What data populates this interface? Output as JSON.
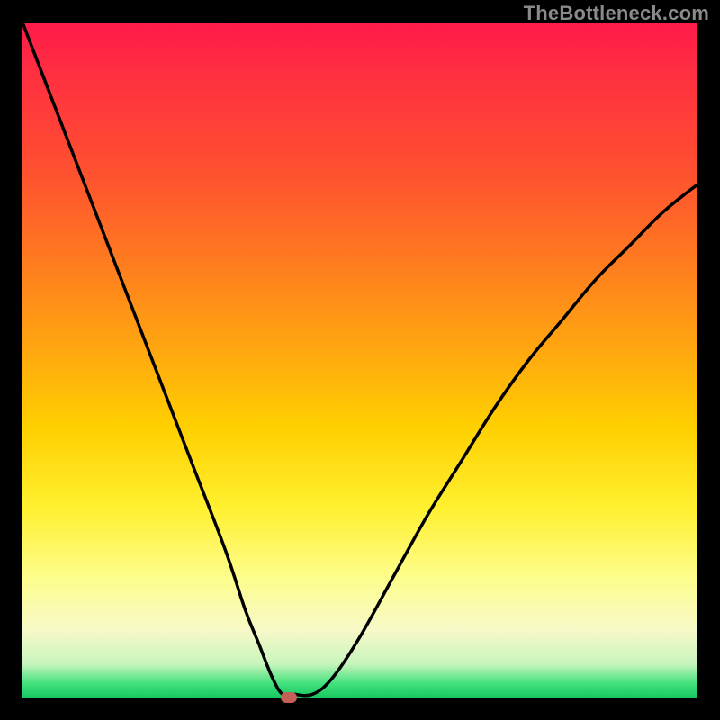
{
  "watermark": "TheBottleneck.com",
  "colors": {
    "frame": "#000000",
    "curve": "#000000",
    "marker": "#c36058"
  },
  "chart_data": {
    "type": "line",
    "title": "",
    "xlabel": "",
    "ylabel": "",
    "xlim": [
      0,
      100
    ],
    "ylim": [
      0,
      100
    ],
    "grid": false,
    "legend": false,
    "gradient_top_color": "#ff1a4a",
    "gradient_bottom_color": "#18c862",
    "series": [
      {
        "name": "bottleneck-curve",
        "x": [
          0,
          5,
          10,
          15,
          20,
          25,
          30,
          33,
          35,
          37,
          38.5,
          40,
          43,
          46,
          50,
          55,
          60,
          65,
          70,
          75,
          80,
          85,
          90,
          95,
          100
        ],
        "y": [
          100,
          87,
          74,
          61,
          48,
          35,
          22,
          13,
          8,
          3,
          0.5,
          0.5,
          0.5,
          3,
          9,
          18,
          27,
          35,
          43,
          50,
          56,
          62,
          67,
          72,
          76
        ]
      }
    ],
    "marker": {
      "x": 39.5,
      "y": 0
    },
    "notes": "x and y are percentages of the plot area; origin at bottom-left. The curve descends steeply from top-left, briefly flattens near x≈38–43 at y≈0, then rises toward the right, ending around y≈76 at x=100."
  }
}
